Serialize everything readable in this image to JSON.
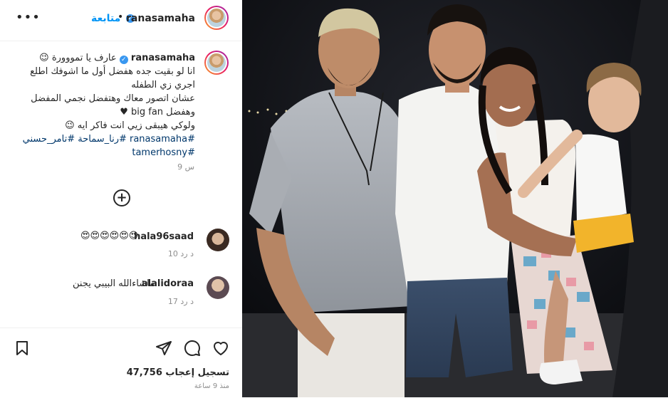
{
  "post": {
    "username": "ranasamaha",
    "follow_label": "متابعة",
    "more_label": "•••",
    "caption_username": "ranasamaha",
    "caption_lines": [
      "عارف يا تمووورة 😉",
      "انا لو بقيت جده هفضل أول ما اشوفك اطلع",
      "اجري زي الطفله",
      "عشان اتصور معاك وهتفضل نجمي المفضل",
      "وهفضل big fan ♥",
      "ولوكي هيبقى زيي انت فاكر ايه 😉"
    ],
    "hashtags_line1": "#ranasamaha #رنا_سماحة #تامر_حسني",
    "hashtags_line2": "#tamerhosny",
    "caption_time": "9 س",
    "add_comment_icon": "plus-circle-icon"
  },
  "comments": [
    {
      "username": "hala96saad",
      "text": "😍😍😍😍😍😍",
      "meta": "10 د  رد"
    },
    {
      "username": "alalidoraa",
      "text": "ماشاءالله البيبي يجنن",
      "meta": "17 د  رد"
    }
  ],
  "footer": {
    "likes": "47,756 تسجيل إعجاب",
    "ago": "منذ 9 ساعة",
    "icons": [
      "bookmark-icon",
      "share-icon",
      "comment-icon",
      "heart-icon"
    ]
  },
  "colors": {
    "accent": "#0095f6",
    "verified": "#3897f0",
    "muted": "#8e8e8e",
    "hashtag": "#00376b"
  }
}
